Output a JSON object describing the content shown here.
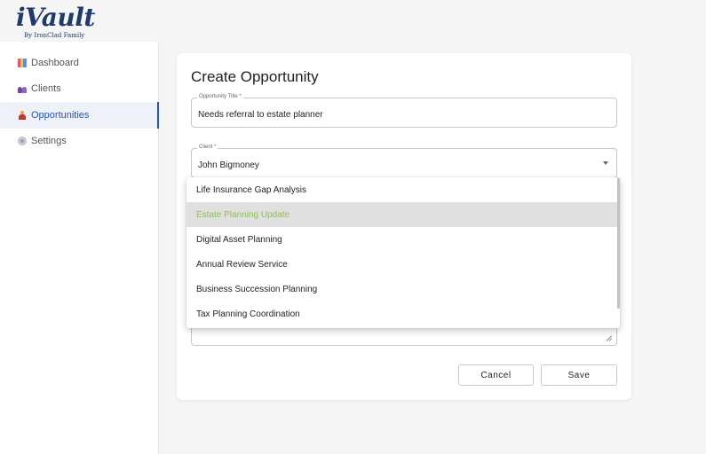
{
  "logo": {
    "word": "iVault",
    "subtitle": "By IronClad Family"
  },
  "sidebar": {
    "items": [
      {
        "label": "Dashboard",
        "icon": "bar-chart-icon"
      },
      {
        "label": "Clients",
        "icon": "people-icon"
      },
      {
        "label": "Opportunities",
        "icon": "person-opportunity-icon",
        "active": true
      },
      {
        "label": "Settings",
        "icon": "gear-icon"
      }
    ]
  },
  "form": {
    "title": "Create Opportunity",
    "opportunity_title": {
      "label": "Opportunity Title *",
      "value": "Needs referral to estate planner"
    },
    "client": {
      "label": "Client *",
      "value": "John Bigmoney"
    },
    "cancel_label": "Cancel",
    "save_label": "Save"
  },
  "dropdown": {
    "options": [
      "Life Insurance Gap Analysis",
      "Estate Planning Update",
      "Digital Asset Planning",
      "Annual Review Service",
      "Business Succession Planning",
      "Tax Planning Coordination"
    ],
    "hovered": "Estate Planning Update"
  },
  "colors": {
    "accent": "#1e57c8",
    "hover_text": "#8bc34a",
    "brand": "#1f3a6b"
  }
}
